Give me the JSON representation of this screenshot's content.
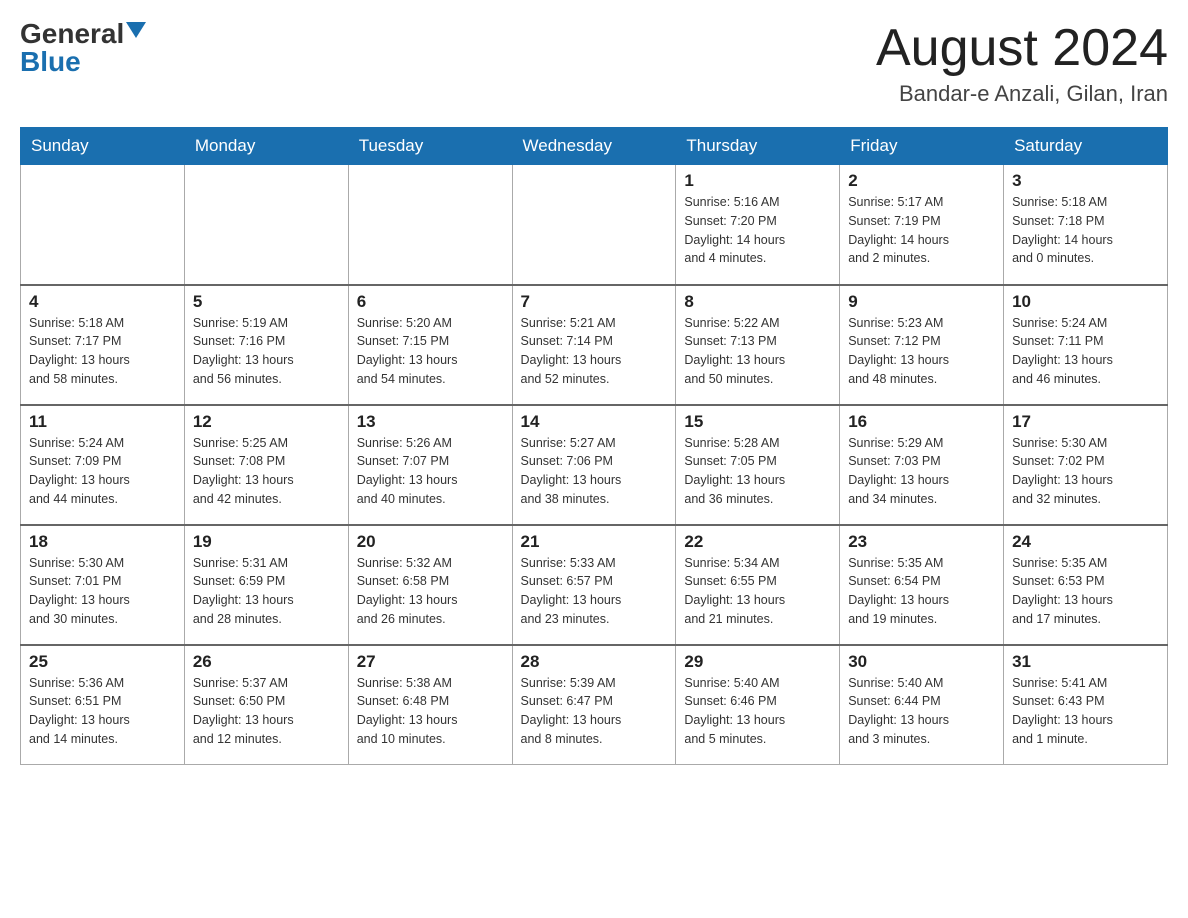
{
  "logo": {
    "general": "General",
    "blue": "Blue"
  },
  "title": "August 2024",
  "location": "Bandar-e Anzali, Gilan, Iran",
  "days_header": [
    "Sunday",
    "Monday",
    "Tuesday",
    "Wednesday",
    "Thursday",
    "Friday",
    "Saturday"
  ],
  "weeks": [
    [
      {
        "day": "",
        "info": ""
      },
      {
        "day": "",
        "info": ""
      },
      {
        "day": "",
        "info": ""
      },
      {
        "day": "",
        "info": ""
      },
      {
        "day": "1",
        "info": "Sunrise: 5:16 AM\nSunset: 7:20 PM\nDaylight: 14 hours\nand 4 minutes."
      },
      {
        "day": "2",
        "info": "Sunrise: 5:17 AM\nSunset: 7:19 PM\nDaylight: 14 hours\nand 2 minutes."
      },
      {
        "day": "3",
        "info": "Sunrise: 5:18 AM\nSunset: 7:18 PM\nDaylight: 14 hours\nand 0 minutes."
      }
    ],
    [
      {
        "day": "4",
        "info": "Sunrise: 5:18 AM\nSunset: 7:17 PM\nDaylight: 13 hours\nand 58 minutes."
      },
      {
        "day": "5",
        "info": "Sunrise: 5:19 AM\nSunset: 7:16 PM\nDaylight: 13 hours\nand 56 minutes."
      },
      {
        "day": "6",
        "info": "Sunrise: 5:20 AM\nSunset: 7:15 PM\nDaylight: 13 hours\nand 54 minutes."
      },
      {
        "day": "7",
        "info": "Sunrise: 5:21 AM\nSunset: 7:14 PM\nDaylight: 13 hours\nand 52 minutes."
      },
      {
        "day": "8",
        "info": "Sunrise: 5:22 AM\nSunset: 7:13 PM\nDaylight: 13 hours\nand 50 minutes."
      },
      {
        "day": "9",
        "info": "Sunrise: 5:23 AM\nSunset: 7:12 PM\nDaylight: 13 hours\nand 48 minutes."
      },
      {
        "day": "10",
        "info": "Sunrise: 5:24 AM\nSunset: 7:11 PM\nDaylight: 13 hours\nand 46 minutes."
      }
    ],
    [
      {
        "day": "11",
        "info": "Sunrise: 5:24 AM\nSunset: 7:09 PM\nDaylight: 13 hours\nand 44 minutes."
      },
      {
        "day": "12",
        "info": "Sunrise: 5:25 AM\nSunset: 7:08 PM\nDaylight: 13 hours\nand 42 minutes."
      },
      {
        "day": "13",
        "info": "Sunrise: 5:26 AM\nSunset: 7:07 PM\nDaylight: 13 hours\nand 40 minutes."
      },
      {
        "day": "14",
        "info": "Sunrise: 5:27 AM\nSunset: 7:06 PM\nDaylight: 13 hours\nand 38 minutes."
      },
      {
        "day": "15",
        "info": "Sunrise: 5:28 AM\nSunset: 7:05 PM\nDaylight: 13 hours\nand 36 minutes."
      },
      {
        "day": "16",
        "info": "Sunrise: 5:29 AM\nSunset: 7:03 PM\nDaylight: 13 hours\nand 34 minutes."
      },
      {
        "day": "17",
        "info": "Sunrise: 5:30 AM\nSunset: 7:02 PM\nDaylight: 13 hours\nand 32 minutes."
      }
    ],
    [
      {
        "day": "18",
        "info": "Sunrise: 5:30 AM\nSunset: 7:01 PM\nDaylight: 13 hours\nand 30 minutes."
      },
      {
        "day": "19",
        "info": "Sunrise: 5:31 AM\nSunset: 6:59 PM\nDaylight: 13 hours\nand 28 minutes."
      },
      {
        "day": "20",
        "info": "Sunrise: 5:32 AM\nSunset: 6:58 PM\nDaylight: 13 hours\nand 26 minutes."
      },
      {
        "day": "21",
        "info": "Sunrise: 5:33 AM\nSunset: 6:57 PM\nDaylight: 13 hours\nand 23 minutes."
      },
      {
        "day": "22",
        "info": "Sunrise: 5:34 AM\nSunset: 6:55 PM\nDaylight: 13 hours\nand 21 minutes."
      },
      {
        "day": "23",
        "info": "Sunrise: 5:35 AM\nSunset: 6:54 PM\nDaylight: 13 hours\nand 19 minutes."
      },
      {
        "day": "24",
        "info": "Sunrise: 5:35 AM\nSunset: 6:53 PM\nDaylight: 13 hours\nand 17 minutes."
      }
    ],
    [
      {
        "day": "25",
        "info": "Sunrise: 5:36 AM\nSunset: 6:51 PM\nDaylight: 13 hours\nand 14 minutes."
      },
      {
        "day": "26",
        "info": "Sunrise: 5:37 AM\nSunset: 6:50 PM\nDaylight: 13 hours\nand 12 minutes."
      },
      {
        "day": "27",
        "info": "Sunrise: 5:38 AM\nSunset: 6:48 PM\nDaylight: 13 hours\nand 10 minutes."
      },
      {
        "day": "28",
        "info": "Sunrise: 5:39 AM\nSunset: 6:47 PM\nDaylight: 13 hours\nand 8 minutes."
      },
      {
        "day": "29",
        "info": "Sunrise: 5:40 AM\nSunset: 6:46 PM\nDaylight: 13 hours\nand 5 minutes."
      },
      {
        "day": "30",
        "info": "Sunrise: 5:40 AM\nSunset: 6:44 PM\nDaylight: 13 hours\nand 3 minutes."
      },
      {
        "day": "31",
        "info": "Sunrise: 5:41 AM\nSunset: 6:43 PM\nDaylight: 13 hours\nand 1 minute."
      }
    ]
  ]
}
